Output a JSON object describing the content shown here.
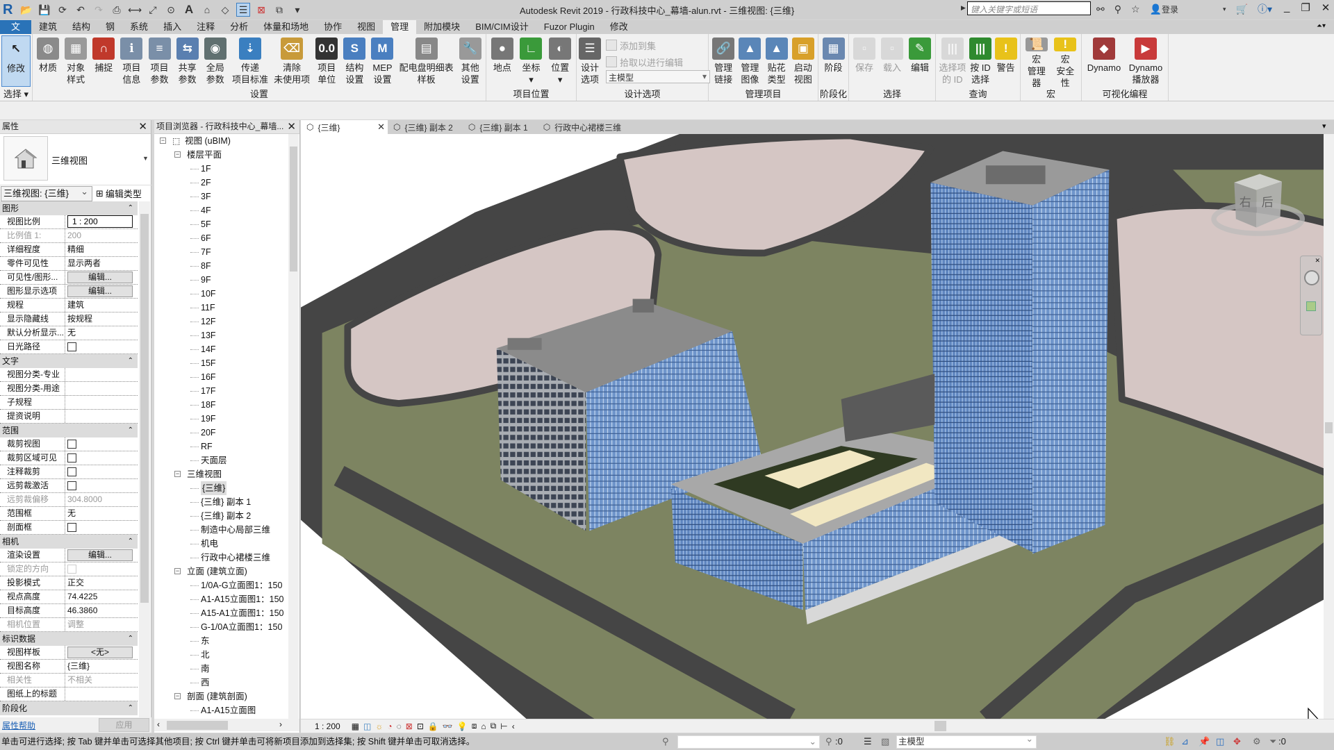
{
  "titlebar": {
    "app_logo": "R",
    "title": "Autodesk Revit 2019 - 行政科技中心_幕墙-alun.rvt - 三维视图: {三维}",
    "search_placeholder": "键入关键字或短语",
    "login": "登录",
    "qat_icons": [
      "open-icon",
      "save-icon",
      "sync-icon",
      "undo-icon",
      "redo-icon",
      "print-icon",
      "measure-icon",
      "aligned-dimension-icon",
      "tag-icon",
      "text-icon",
      "3d-view-icon",
      "section-icon",
      "thin-lines-icon",
      "close-hidden-icon",
      "switch-windows-icon",
      "customize-icon"
    ]
  },
  "menu_tabs": [
    {
      "label": "文件",
      "kind": "file"
    },
    {
      "label": "建筑"
    },
    {
      "label": "结构"
    },
    {
      "label": "钢"
    },
    {
      "label": "系统"
    },
    {
      "label": "插入"
    },
    {
      "label": "注释"
    },
    {
      "label": "分析"
    },
    {
      "label": "体量和场地"
    },
    {
      "label": "协作"
    },
    {
      "label": "视图"
    },
    {
      "label": "管理",
      "kind": "sel"
    },
    {
      "label": "附加模块"
    },
    {
      "label": "BIM/CIM设计"
    },
    {
      "label": "Fuzor Plugin"
    },
    {
      "label": "修改"
    }
  ],
  "ribbon": {
    "panels": [
      {
        "label": "选择 ▾",
        "buttons": [
          {
            "label": "修改",
            "icon": "cursor-icon",
            "color": "#c0d9f1",
            "glyph": "↖",
            "big": true
          }
        ]
      },
      {
        "label": "设置",
        "buttons": [
          {
            "label": "材质",
            "icon": "material-sphere-icon",
            "color": "#8a8a8a",
            "glyph": "◍"
          },
          {
            "label": "对象\n样式",
            "icon": "object-styles-icon",
            "color": "#9a9a9a",
            "glyph": "▦"
          },
          {
            "label": "捕捉",
            "icon": "snap-magnet-icon",
            "color": "#c0392b",
            "glyph": "∩"
          },
          {
            "label": "项目\n信息",
            "icon": "project-info-icon",
            "color": "#7a8fa8",
            "glyph": "ℹ"
          },
          {
            "label": "项目\n参数",
            "icon": "project-params-icon",
            "color": "#7a8fa8",
            "glyph": "≡"
          },
          {
            "label": "共享\n参数",
            "icon": "shared-params-icon",
            "color": "#5a7fb0",
            "glyph": "⇆"
          },
          {
            "label": "全局\n参数",
            "icon": "global-params-icon",
            "color": "#607070",
            "glyph": "◉"
          },
          {
            "label": "传递\n项目标准",
            "icon": "transfer-standards-icon",
            "color": "#3a7fc0",
            "glyph": "⇣"
          },
          {
            "label": "清除\n未使用项",
            "icon": "purge-broom-icon",
            "color": "#c89a3a",
            "glyph": "⌫"
          },
          {
            "label": "项目\n单位",
            "icon": "project-units-icon",
            "color": "#333",
            "glyph": "0.0"
          },
          {
            "label": "结构\n设置",
            "icon": "structural-settings-icon",
            "color": "#4a7fc0",
            "glyph": "S"
          },
          {
            "label": "MEP\n设置",
            "icon": "mep-settings-icon",
            "color": "#4a7fc0",
            "glyph": "M"
          },
          {
            "label": "配电盘明细表\n样板",
            "icon": "panel-schedule-icon",
            "color": "#888",
            "glyph": "▤"
          },
          {
            "label": "其他\n设置",
            "icon": "wrench-icon",
            "color": "#999",
            "glyph": "🔧"
          }
        ]
      },
      {
        "label": "项目位置",
        "buttons": [
          {
            "label": "地点",
            "icon": "location-globe-icon",
            "color": "#777",
            "glyph": "●"
          },
          {
            "label": "坐标\n▾",
            "icon": "coordinates-icon",
            "color": "#3a9a3a",
            "glyph": "∟"
          },
          {
            "label": "位置\n▾",
            "icon": "position-icon",
            "color": "#777",
            "glyph": "◐"
          }
        ]
      },
      {
        "label": "设计选项",
        "buttons": [
          {
            "label": "设计\n选项",
            "icon": "design-options-icon",
            "color": "#666",
            "glyph": "☰"
          }
        ],
        "small": [
          {
            "label": "添加到集",
            "icon": "add-to-set-icon"
          },
          {
            "label": "拾取以进行编辑",
            "icon": "pick-to-edit-icon"
          }
        ],
        "select": "主模型"
      },
      {
        "label": "管理项目",
        "buttons": [
          {
            "label": "管理\n链接",
            "icon": "manage-links-icon",
            "color": "#777",
            "glyph": "🔗"
          },
          {
            "label": "管理\n图像",
            "icon": "manage-images-icon",
            "color": "#5a86b8",
            "glyph": "▲"
          },
          {
            "label": "贴花\n类型",
            "icon": "decal-types-icon",
            "color": "#5a86b8",
            "glyph": "▲"
          },
          {
            "label": "启动\n视图",
            "icon": "starting-view-icon",
            "color": "#d8a02a",
            "glyph": "▣"
          }
        ]
      },
      {
        "label": "阶段化",
        "buttons": [
          {
            "label": "阶段",
            "icon": "phases-icon",
            "color": "#6a88b0",
            "glyph": "▦"
          }
        ]
      },
      {
        "label": "选择",
        "buttons": [
          {
            "label": "保存",
            "icon": "save-selection-icon",
            "color": "#aaa",
            "glyph": "▫",
            "dis": true
          },
          {
            "label": "载入",
            "icon": "load-selection-icon",
            "color": "#aaa",
            "glyph": "▫",
            "dis": true
          },
          {
            "label": "编辑",
            "icon": "edit-selection-icon",
            "color": "#3a9a3a",
            "glyph": "✎"
          }
        ]
      },
      {
        "label": "查询",
        "buttons": [
          {
            "label": "选择项\n的 ID",
            "icon": "ids-of-selection-icon",
            "color": "#aaa",
            "glyph": "|||",
            "dis": true
          },
          {
            "label": "按 ID\n选择",
            "icon": "select-by-id-icon",
            "color": "#2f8a2f",
            "glyph": "|||"
          },
          {
            "label": "警告",
            "icon": "warning-icon",
            "color": "#e8c21a",
            "glyph": "!"
          }
        ]
      },
      {
        "label": "宏",
        "buttons": [
          {
            "label": "宏\n管理器",
            "icon": "macro-manager-icon",
            "color": "#999",
            "glyph": "📜"
          },
          {
            "label": "宏\n安全性",
            "icon": "macro-security-icon",
            "color": "#e8c21a",
            "glyph": "!"
          }
        ]
      },
      {
        "label": "可视化编程",
        "buttons": [
          {
            "label": "Dynamo",
            "icon": "dynamo-icon",
            "color": "#a03a3a",
            "glyph": "◆"
          },
          {
            "label": "Dynamo\n播放器",
            "icon": "dynamo-player-icon",
            "color": "#c83a3a",
            "glyph": "▶"
          }
        ]
      }
    ]
  },
  "properties": {
    "title": "属性",
    "type_name": "三维视图",
    "type_selector": "三维视图: {三维}",
    "edit_type": "编辑类型",
    "help": "属性帮助",
    "apply": "应用",
    "sections": [
      {
        "title": "图形",
        "rows": [
          {
            "k": "视图比例",
            "v": "1 : 200",
            "t": "input"
          },
          {
            "k": "比例值 1:",
            "v": "200",
            "dim": true
          },
          {
            "k": "详细程度",
            "v": "精细"
          },
          {
            "k": "零件可见性",
            "v": "显示两者"
          },
          {
            "k": "可见性/图形...",
            "v": "编辑...",
            "t": "button"
          },
          {
            "k": "图形显示选项",
            "v": "编辑...",
            "t": "button"
          },
          {
            "k": "规程",
            "v": "建筑"
          },
          {
            "k": "显示隐藏线",
            "v": "按规程"
          },
          {
            "k": "默认分析显示...",
            "v": "无"
          },
          {
            "k": "日光路径",
            "v": false,
            "t": "check"
          }
        ]
      },
      {
        "title": "文字",
        "rows": [
          {
            "k": "视图分类-专业",
            "v": ""
          },
          {
            "k": "视图分类-用途",
            "v": ""
          },
          {
            "k": "子规程",
            "v": ""
          },
          {
            "k": "提资说明",
            "v": ""
          }
        ]
      },
      {
        "title": "范围",
        "rows": [
          {
            "k": "裁剪视图",
            "v": false,
            "t": "check"
          },
          {
            "k": "裁剪区域可见",
            "v": false,
            "t": "check"
          },
          {
            "k": "注释裁剪",
            "v": false,
            "t": "check"
          },
          {
            "k": "远剪裁激活",
            "v": false,
            "t": "check"
          },
          {
            "k": "远剪裁偏移",
            "v": "304.8000",
            "dim": true
          },
          {
            "k": "范围框",
            "v": "无"
          },
          {
            "k": "剖面框",
            "v": false,
            "t": "check"
          }
        ]
      },
      {
        "title": "相机",
        "rows": [
          {
            "k": "渲染设置",
            "v": "编辑...",
            "t": "button"
          },
          {
            "k": "锁定的方向",
            "v": false,
            "t": "check",
            "dim": true
          },
          {
            "k": "投影模式",
            "v": "正交"
          },
          {
            "k": "视点高度",
            "v": "74.4225"
          },
          {
            "k": "目标高度",
            "v": "46.3860"
          },
          {
            "k": "相机位置",
            "v": "调整",
            "dim": true
          }
        ]
      },
      {
        "title": "标识数据",
        "rows": [
          {
            "k": "视图样板",
            "v": "<无>",
            "t": "button"
          },
          {
            "k": "视图名称",
            "v": "{三维}"
          },
          {
            "k": "相关性",
            "v": "不相关",
            "dim": true
          },
          {
            "k": "图纸上的标题",
            "v": ""
          }
        ]
      },
      {
        "title": "阶段化",
        "rows": []
      }
    ]
  },
  "browser": {
    "title": "项目浏览器 - 行政科技中心_幕墙...",
    "items": [
      {
        "t": "视图 (uBIM)",
        "l": 0,
        "exp": true
      },
      {
        "t": "楼层平面",
        "l": 1,
        "exp": true
      },
      {
        "t": "1F",
        "l": 2
      },
      {
        "t": "2F",
        "l": 2
      },
      {
        "t": "3F",
        "l": 2
      },
      {
        "t": "4F",
        "l": 2
      },
      {
        "t": "5F",
        "l": 2
      },
      {
        "t": "6F",
        "l": 2
      },
      {
        "t": "7F",
        "l": 2
      },
      {
        "t": "8F",
        "l": 2
      },
      {
        "t": "9F",
        "l": 2
      },
      {
        "t": "10F",
        "l": 2
      },
      {
        "t": "11F",
        "l": 2
      },
      {
        "t": "12F",
        "l": 2
      },
      {
        "t": "13F",
        "l": 2
      },
      {
        "t": "14F",
        "l": 2
      },
      {
        "t": "15F",
        "l": 2
      },
      {
        "t": "16F",
        "l": 2
      },
      {
        "t": "17F",
        "l": 2
      },
      {
        "t": "18F",
        "l": 2
      },
      {
        "t": "19F",
        "l": 2
      },
      {
        "t": "20F",
        "l": 2
      },
      {
        "t": "RF",
        "l": 2
      },
      {
        "t": "天面层",
        "l": 2
      },
      {
        "t": "三维视图",
        "l": 1,
        "exp": true
      },
      {
        "t": "{三维}",
        "l": 2,
        "sel": true
      },
      {
        "t": "{三维} 副本 1",
        "l": 2
      },
      {
        "t": "{三维} 副本 2",
        "l": 2
      },
      {
        "t": "制造中心局部三维",
        "l": 2
      },
      {
        "t": "机电",
        "l": 2
      },
      {
        "t": "行政中心裙楼三维",
        "l": 2
      },
      {
        "t": "立面 (建筑立面)",
        "l": 1,
        "exp": true
      },
      {
        "t": "1/0A-G立面图1：150",
        "l": 2
      },
      {
        "t": "A1-A15立面图1：150",
        "l": 2
      },
      {
        "t": "A15-A1立面图1：150",
        "l": 2
      },
      {
        "t": "G-1/0A立面图1：150",
        "l": 2
      },
      {
        "t": "东",
        "l": 2
      },
      {
        "t": "北",
        "l": 2
      },
      {
        "t": "南",
        "l": 2
      },
      {
        "t": "西",
        "l": 2
      },
      {
        "t": "剖面 (建筑剖面)",
        "l": 1,
        "exp": true
      },
      {
        "t": "A1-A15立面图",
        "l": 2
      }
    ]
  },
  "view_tabs": [
    {
      "label": "{三维}",
      "active": true
    },
    {
      "label": "{三维} 副本 2"
    },
    {
      "label": "{三维} 副本 1"
    },
    {
      "label": "行政中心裙楼三维"
    }
  ],
  "viewcube": {
    "right": "右",
    "back": "后"
  },
  "view_control": {
    "scale": "1 : 200"
  },
  "status": {
    "message": "单击可进行选择; 按 Tab 键并单击可选择其他项目; 按 Ctrl 键并单击可将新项目添加到选择集; 按 Shift 键并单击可取消选择。",
    "workset": "",
    "editable_count": ":0",
    "design_option": "主模型",
    "filter_count": ":0"
  },
  "colors": {
    "accent": "#2a73b8",
    "asphalt": "#454545",
    "lawn": "#7d8461",
    "lot": "#d5c6c4",
    "glass": "#7399cc"
  }
}
